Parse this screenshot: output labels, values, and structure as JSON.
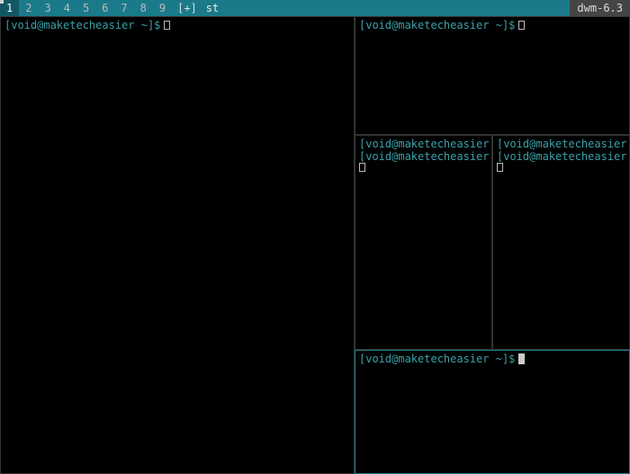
{
  "statusbar": {
    "tags": [
      "1",
      "2",
      "3",
      "4",
      "5",
      "6",
      "7",
      "8",
      "9"
    ],
    "selected_tag_index": 0,
    "layout_symbol": "[+]",
    "title": "st",
    "wm_version": "dwm-6.3"
  },
  "prompt_text": "[void@maketecheasier ~]$",
  "windows": {
    "master": {
      "prompt": "[void@maketecheasier ~]$"
    },
    "top_right": {
      "prompt": "[void@maketecheasier ~]$"
    },
    "mid_left": {
      "line1": "[void@maketecheasier ~]$",
      "line2": "[void@maketecheasier ~]$"
    },
    "mid_right": {
      "line1": "[void@maketecheasier ~]$",
      "line2": "[void@maketecheasier ~]$"
    },
    "bottom": {
      "prompt": "[void@maketecheasier ~]$"
    }
  }
}
